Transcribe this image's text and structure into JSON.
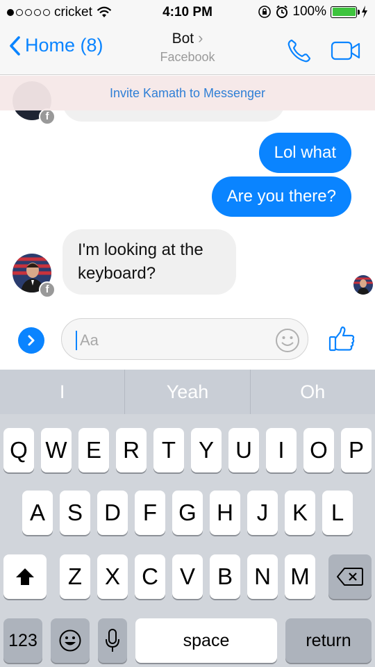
{
  "status_bar": {
    "carrier": "cricket",
    "time": "4:10 PM",
    "battery": "100%",
    "battery_level": 1.0
  },
  "nav": {
    "back_label": "Home (8)",
    "title": "Bot",
    "subtitle": "Facebook",
    "icons": [
      "phone-icon",
      "video-camera-icon"
    ]
  },
  "banner": {
    "invite_text": "Invite Kamath to Messenger"
  },
  "messages": [
    {
      "from": "me",
      "text": "Lol what"
    },
    {
      "from": "me",
      "text": "Are you there?"
    },
    {
      "from": "bot",
      "text": "I'm looking at the keyboard?"
    }
  ],
  "composer": {
    "placeholder": "Aa",
    "icons": [
      "chevron-right-icon",
      "smiley-icon",
      "thumbs-up-icon"
    ]
  },
  "keyboard": {
    "predictions": [
      "I",
      "Yeah",
      "Oh"
    ],
    "row1": [
      "Q",
      "W",
      "E",
      "R",
      "T",
      "Y",
      "U",
      "I",
      "O",
      "P"
    ],
    "row2": [
      "A",
      "S",
      "D",
      "F",
      "G",
      "H",
      "J",
      "K",
      "L"
    ],
    "row3": [
      "Z",
      "X",
      "C",
      "V",
      "B",
      "N",
      "M"
    ],
    "numbers_key": "123",
    "space_key": "space",
    "return_key": "return",
    "icons": [
      "shift-icon",
      "backspace-icon",
      "emoji-icon",
      "microphone-icon"
    ]
  },
  "colors": {
    "accent": "#0a84ff",
    "incoming_bubble": "#f0f0f0",
    "keyboard_bg": "#d1d5db"
  }
}
